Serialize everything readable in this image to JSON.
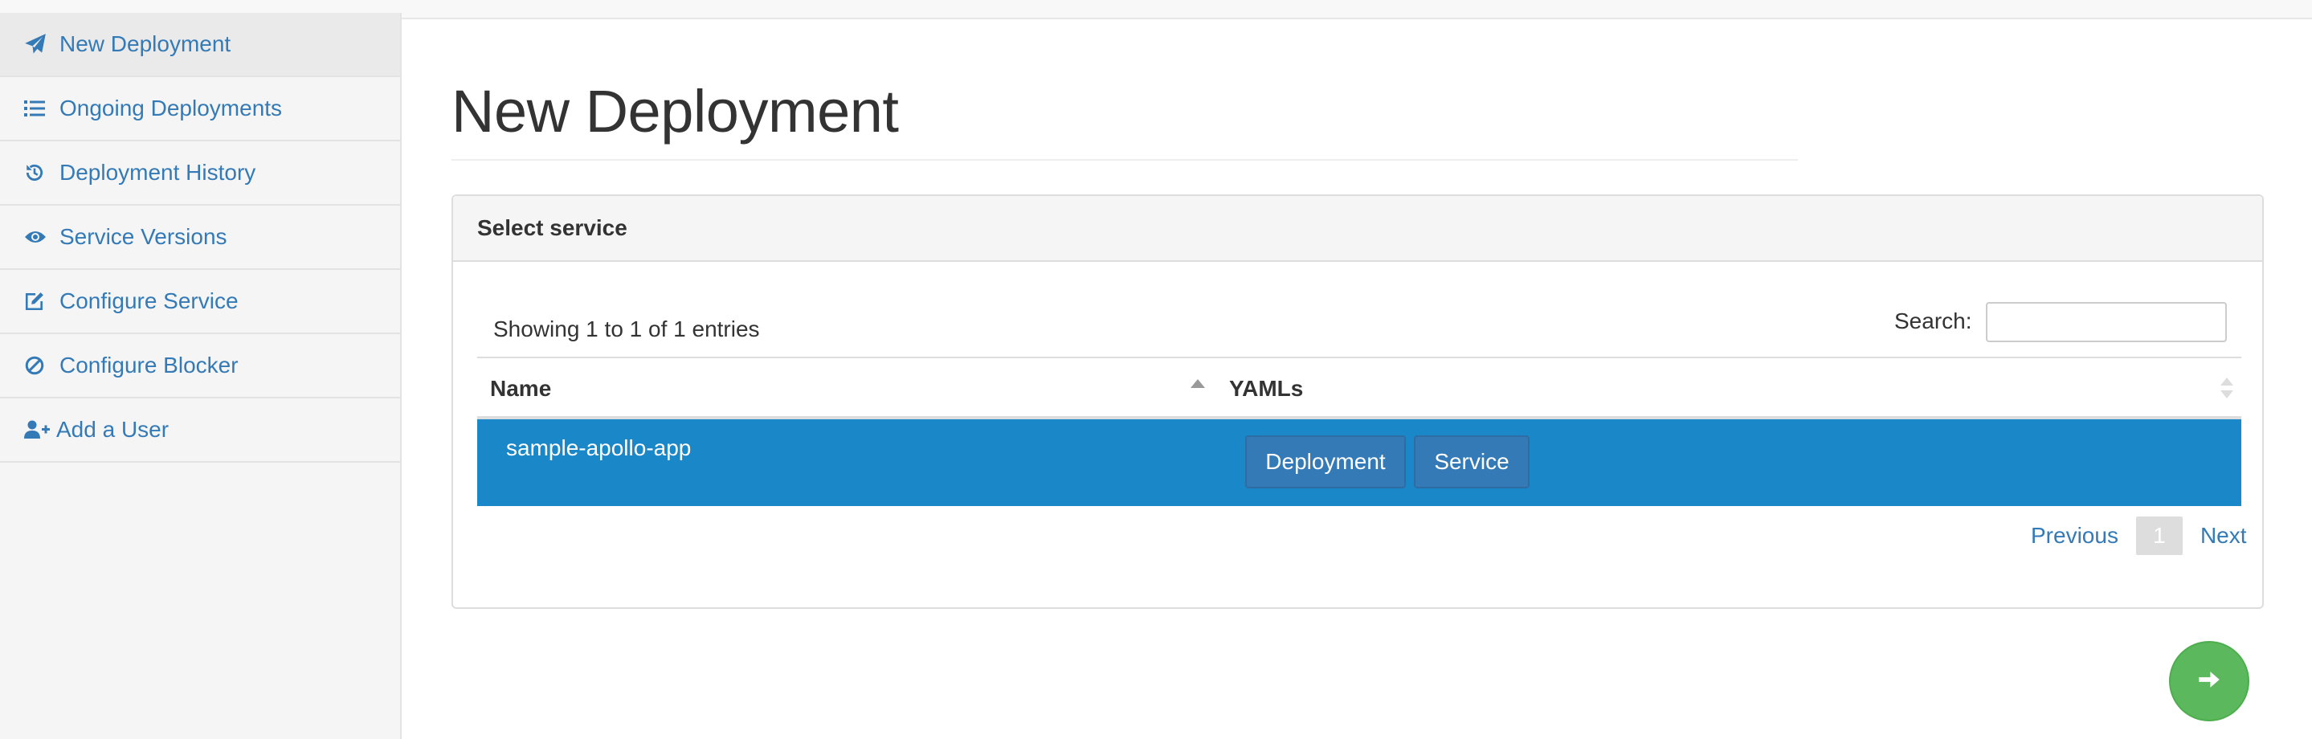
{
  "sidebar": {
    "items": [
      {
        "label": "New Deployment",
        "icon": "paper-plane-icon",
        "active": true
      },
      {
        "label": "Ongoing Deployments",
        "icon": "list-icon"
      },
      {
        "label": "Deployment History",
        "icon": "history-icon"
      },
      {
        "label": "Service Versions",
        "icon": "eye-icon"
      },
      {
        "label": "Configure Service",
        "icon": "edit-icon"
      },
      {
        "label": "Configure Blocker",
        "icon": "ban-icon"
      },
      {
        "label": "Add a User",
        "icon": "user-plus-icon"
      }
    ]
  },
  "main": {
    "title": "New Deployment",
    "panel": {
      "heading": "Select service",
      "info": "Showing 1 to 1 of 1 entries",
      "search": {
        "label": "Search:",
        "value": "",
        "placeholder": ""
      },
      "table": {
        "columns": [
          {
            "label": "Name",
            "sort": "ascending"
          },
          {
            "label": "YAMLs",
            "sort": "none"
          }
        ],
        "rows": [
          {
            "name": "sample-apollo-app",
            "selected": true,
            "yamls": [
              "Deployment",
              "Service"
            ]
          }
        ]
      },
      "pagination": {
        "previous": "Previous",
        "current": "1",
        "next": "Next"
      }
    },
    "next_button": {
      "icon": "arrow-right-icon"
    }
  },
  "colors": {
    "link": "#337ab7",
    "selected_row": "#1a87c9",
    "button_primary": "#337ab7",
    "fab_green": "#5cb85c"
  }
}
